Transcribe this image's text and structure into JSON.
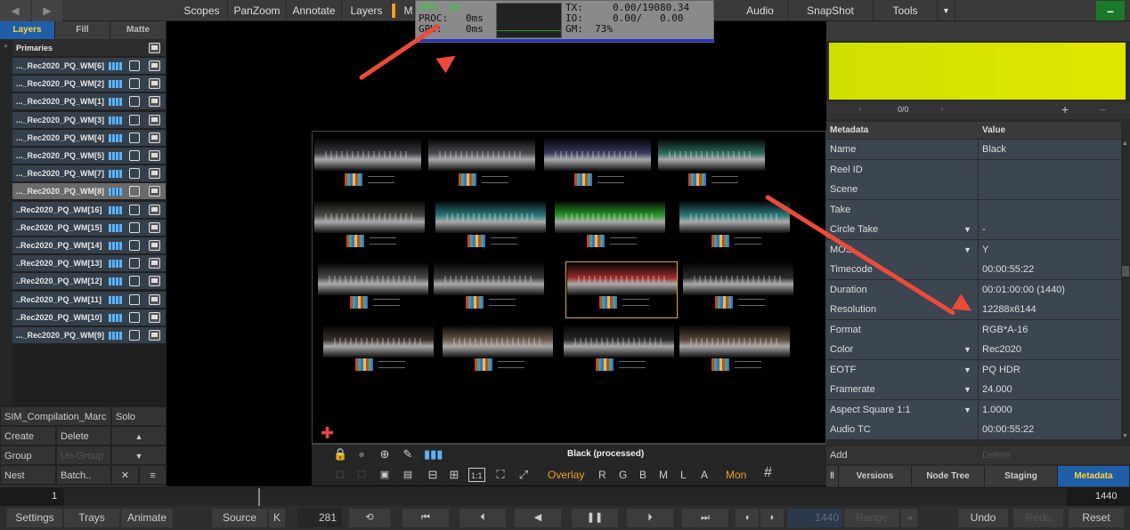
{
  "topbar": {
    "tabs": [
      "Scopes",
      "PanZoom",
      "Annotate",
      "Layers",
      "M",
      "Audio",
      "SnapShot",
      "Tools"
    ],
    "green_button": "–"
  },
  "stats": {
    "fps_label": "FPS:",
    "fps_value": "24",
    "proc": "PROC:   0ms",
    "gpu": "GPU:    0ms",
    "tx": "TX:     0.00/19080.34",
    "io": "IO:     0.00/   0.00",
    "gm": "GM:  73%"
  },
  "left": {
    "tabs": [
      "Layers",
      "Fill",
      "Matte"
    ],
    "section": "Primaries",
    "layers": [
      "..._Rec2020_PQ_WM[6]",
      "..._Rec2020_PQ_WM[2]",
      "..._Rec2020_PQ_WM[1]",
      "..._Rec2020_PQ_WM[3]",
      "..._Rec2020_PQ_WM[4]",
      "..._Rec2020_PQ_WM[5]",
      "..._Rec2020_PQ_WM[7]",
      "..._Rec2020_PQ_WM[8]",
      "..Rec2020_PQ_WM[16]",
      "..Rec2020_PQ_WM[15]",
      "..Rec2020_PQ_WM[14]",
      "..Rec2020_PQ_WM[13]",
      "..Rec2020_PQ_WM[12]",
      "..Rec2020_PQ_WM[11]",
      "..Rec2020_PQ_WM[10]",
      "..._Rec2020_PQ_WM[9]"
    ],
    "comp_name": "SIM_Compilation_Marc",
    "solo": "Solo",
    "create": "Create",
    "delete": "Delete",
    "group": "Group",
    "ungroup": "Un-Group",
    "nest": "Nest",
    "batch": "Batch..",
    "up": "▲",
    "down": "▼",
    "close": "✕",
    "menu": "≡"
  },
  "viewer": {
    "status": "Black (processed)",
    "overlay": "Overlay",
    "channels": [
      "R",
      "G",
      "B",
      "M",
      "L",
      "A"
    ],
    "mon": "Mon",
    "ratio": "1:1",
    "hash": "#"
  },
  "right": {
    "nav_count": "0/0",
    "plus": "+",
    "minus": "−",
    "header_key": "Metadata",
    "header_value": "Value",
    "rows": [
      {
        "k": "Name",
        "v": "Black",
        "dd": ""
      },
      {
        "k": "Reel ID",
        "v": "",
        "dd": ""
      },
      {
        "k": "Scene",
        "v": "",
        "dd": ""
      },
      {
        "k": "Take",
        "v": "",
        "dd": ""
      },
      {
        "k": "Circle Take",
        "v": "-",
        "dd": "▼"
      },
      {
        "k": "MOS",
        "v": "Y",
        "dd": "▼"
      },
      {
        "k": "Timecode",
        "v": "00:00:55:22",
        "dd": ""
      },
      {
        "k": "Duration",
        "v": "00:01:00:00 (1440)",
        "dd": ""
      },
      {
        "k": "Resolution",
        "v": "12288x6144",
        "dd": ""
      },
      {
        "k": "Format",
        "v": " RGB*A-16",
        "dd": ""
      },
      {
        "k": "Color",
        "v": "Rec2020",
        "dd": "▼"
      },
      {
        "k": "EOTF",
        "v": "PQ HDR",
        "dd": "▼"
      },
      {
        "k": "Framerate",
        "v": "24.000",
        "dd": "▼"
      },
      {
        "k": "Aspect Square 1:1",
        "v": "1.0000",
        "dd": "▼"
      },
      {
        "k": "Audio TC",
        "v": "00:00:55:22",
        "dd": ""
      }
    ],
    "add": "Add",
    "delete": "Delete",
    "tabs": [
      "Versions",
      "Node Tree",
      "Staging",
      "Metadata"
    ]
  },
  "timeline": {
    "start": "1",
    "end": "1440"
  },
  "bottom": {
    "settings": "Settings",
    "trays": "Trays",
    "animate": "Animate",
    "source": "Source",
    "k": "K",
    "frame": "281",
    "end_frame": "1440",
    "range": "Range",
    "undo": "Undo",
    "redo": "Redo",
    "reset": "Reset"
  },
  "colors": {
    "accent": "#1e5fa8",
    "tab_text_active": "#ffd23c",
    "annotation_arrow": "#ee4a3a",
    "swatch": "#d8e400"
  }
}
